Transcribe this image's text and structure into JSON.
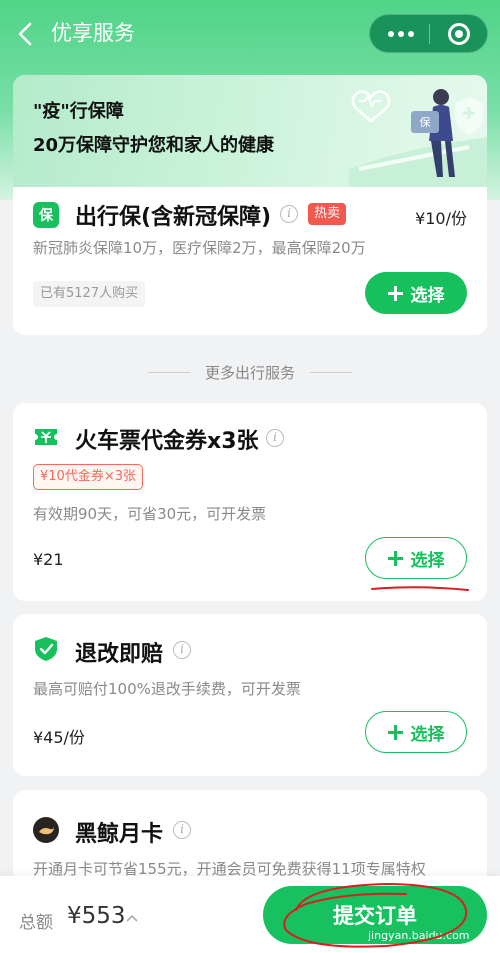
{
  "nav": {
    "title": "优享服务"
  },
  "insurance": {
    "banner_line1": "\"疫\"行保障",
    "banner_line2": "20万保障守护您和家人的健康",
    "illustration_label": "保",
    "icon_label": "保",
    "title": "出行保(含新冠保障)",
    "hot_badge": "热卖",
    "price": "¥10/份",
    "desc": "新冠肺炎保障10万，医疗保障2万，最高保障20万",
    "sold": "已有5127人购买",
    "button": "选择"
  },
  "divider": {
    "text": "更多出行服务"
  },
  "items": [
    {
      "title": "火车票代金券x3张",
      "tag": "¥10代金券×3张",
      "desc": "有效期90天，可省30元，可开发票",
      "price": "¥21",
      "button": "选择",
      "icon": "ticket-icon"
    },
    {
      "title": "退改即赔",
      "desc": "最高可赔付100%退改手续费，可开发票",
      "price": "¥45/份",
      "button": "选择",
      "icon": "shield-check-icon"
    },
    {
      "title": "黑鲸月卡",
      "desc": "开通月卡可节省155元，开通会员可免费获得11项专属特权",
      "icon": "whale-icon"
    }
  ],
  "footer": {
    "total_label": "总额",
    "total_value": "¥553",
    "submit": "提交订单"
  },
  "watermark": "jingyan.baidu.com",
  "colors": {
    "brand_green": "#16c05c",
    "hot_red": "#f1584e",
    "annotation_red": "#d81e1e"
  }
}
